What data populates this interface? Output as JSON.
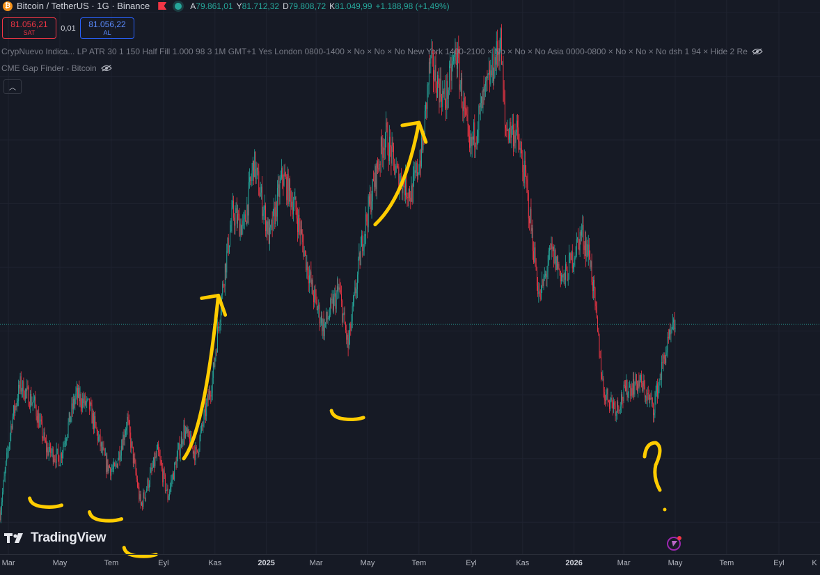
{
  "header": {
    "title": "Bitcoin / TetherUS · 1G · Binance",
    "ohlc": [
      {
        "label": "A",
        "value": "79.861,01"
      },
      {
        "label": "Y",
        "value": "81.712,32"
      },
      {
        "label": "D",
        "value": "79.808,72"
      },
      {
        "label": "K",
        "value": "81.049,99"
      },
      {
        "label": "",
        "value": "+1.188,98 (+1,49%)"
      }
    ]
  },
  "trade": {
    "sell_price": "81.056,21",
    "sell_label": "SAT",
    "spread": "0,01",
    "buy_price": "81.056,22",
    "buy_label": "AL"
  },
  "indicators": [
    "CrypNuevo Indica... LP ATR 30 1 150 Half Fill 1.000 98 3 1M GMT+1 Yes London 0800-1400 × No × No × No New York 1400-2100 × No × No × No Asia 0000-0800 × No × No × No dsh 1 94 × Hide 2 Re",
    "CME Gap Finder - Bitcoin"
  ],
  "branding": {
    "logo_text": "TradingView"
  },
  "colors": {
    "background": "#161a25",
    "up": "#26a69a",
    "down": "#f23645",
    "annotation": "#ffcc00",
    "grid": "#1f2330",
    "current_price_line": "#26a69a"
  },
  "chart_data": {
    "type": "candlestick",
    "symbol": "Bitcoin / TetherUS",
    "timeframe": "1G",
    "exchange": "Binance",
    "x_axis_labels": [
      "Mar",
      "May",
      "Tem",
      "Eyl",
      "Kas",
      "2025",
      "Mar",
      "May",
      "Tem",
      "Eyl",
      "Kas",
      "2026",
      "Mar",
      "May",
      "Tem",
      "Eyl",
      "K"
    ],
    "series": [
      {
        "x": [
          "2024-02-20",
          "2024-03-05",
          "2024-03-15",
          "2024-04-01",
          "2024-04-15",
          "2024-05-01",
          "2024-05-20",
          "2024-06-05",
          "2024-06-25",
          "2024-07-05",
          "2024-07-20",
          "2024-08-05",
          "2024-08-25",
          "2024-09-06",
          "2024-09-25",
          "2024-10-10",
          "2024-10-29",
          "2024-11-12",
          "2024-11-22",
          "2024-12-05",
          "2024-12-17",
          "2025-01-05",
          "2025-01-20",
          "2025-02-05",
          "2025-02-25",
          "2025-03-10",
          "2025-03-28",
          "2025-04-08",
          "2025-04-25",
          "2025-05-10",
          "2025-05-22",
          "2025-06-05",
          "2025-06-22",
          "2025-07-05",
          "2025-07-14",
          "2025-08-01",
          "2025-08-14",
          "2025-08-30",
          "2025-09-15",
          "2025-10-06",
          "2025-10-11",
          "2025-10-25",
          "2025-11-05",
          "2025-11-21",
          "2025-12-05",
          "2025-12-20",
          "2026-01-10",
          "2026-01-20",
          "2026-02-05",
          "2026-02-20",
          "2026-03-05",
          "2026-03-20",
          "2026-04-05",
          "2026-04-20",
          "2026-05-01"
        ],
        "values": [
          51500,
          66000,
          71500,
          68500,
          61500,
          60000,
          70000,
          68000,
          59000,
          58000,
          66000,
          52500,
          61000,
          54000,
          64500,
          60500,
          72500,
          89000,
          98500,
          96000,
          106500,
          94500,
          104500,
          99000,
          86000,
          80500,
          86500,
          77500,
          94500,
          104000,
          111000,
          104500,
          101500,
          108500,
          122000,
          116000,
          124000,
          108000,
          116000,
          125500,
          112000,
          111000,
          103000,
          85000,
          92500,
          88000,
          95500,
          91500,
          70500,
          68000,
          71000,
          72000,
          68000,
          77000,
          81050
        ]
      }
    ],
    "ylim": [
      45000,
      130000
    ],
    "current_price": 81050,
    "annotations": [
      {
        "type": "marker",
        "at": "2024-04-15"
      },
      {
        "type": "marker",
        "at": "2024-06-25"
      },
      {
        "type": "marker",
        "at": "2024-08-05"
      },
      {
        "type": "arrow_up",
        "from": "2024-09-25",
        "to": "2024-11-05"
      },
      {
        "type": "marker",
        "at": "2025-04-08"
      },
      {
        "type": "arrow_up",
        "from": "2025-05-10",
        "to": "2025-07-01"
      },
      {
        "type": "question",
        "at": "2026-03-05",
        "text": "?"
      }
    ]
  }
}
